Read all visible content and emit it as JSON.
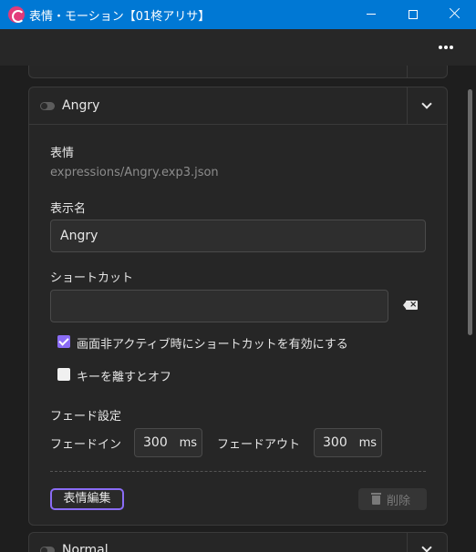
{
  "window": {
    "title": "表情・モーション【01柊アリサ】"
  },
  "toolbar": {
    "more_icon": "ellipsis-horizontal-icon"
  },
  "cards": {
    "main": {
      "name": "Angry",
      "expression_label": "表情",
      "expression_path": "expressions/Angry.exp3.json",
      "display_name_label": "表示名",
      "display_name_value": "Angry",
      "shortcut_label": "ショートカット",
      "shortcut_value": "",
      "inactive_shortcut_label": "画面非アクティブ時にショートカットを有効にする",
      "inactive_shortcut_checked": true,
      "key_release_off_label": "キーを離すとオフ",
      "key_release_off_checked": false,
      "fade_settings_label": "フェード設定",
      "fade_in_label": "フェードイン",
      "fade_in_value": "300",
      "fade_out_label": "フェードアウト",
      "fade_out_value": "300",
      "unit": "ms",
      "edit_button": "表情編集",
      "delete_button": "削除"
    },
    "next": {
      "name": "Normal"
    }
  },
  "colors": {
    "titlebar": "#0078d4",
    "accent": "#8a6cf5",
    "background": "#1e1e1e",
    "card": "#262626"
  }
}
